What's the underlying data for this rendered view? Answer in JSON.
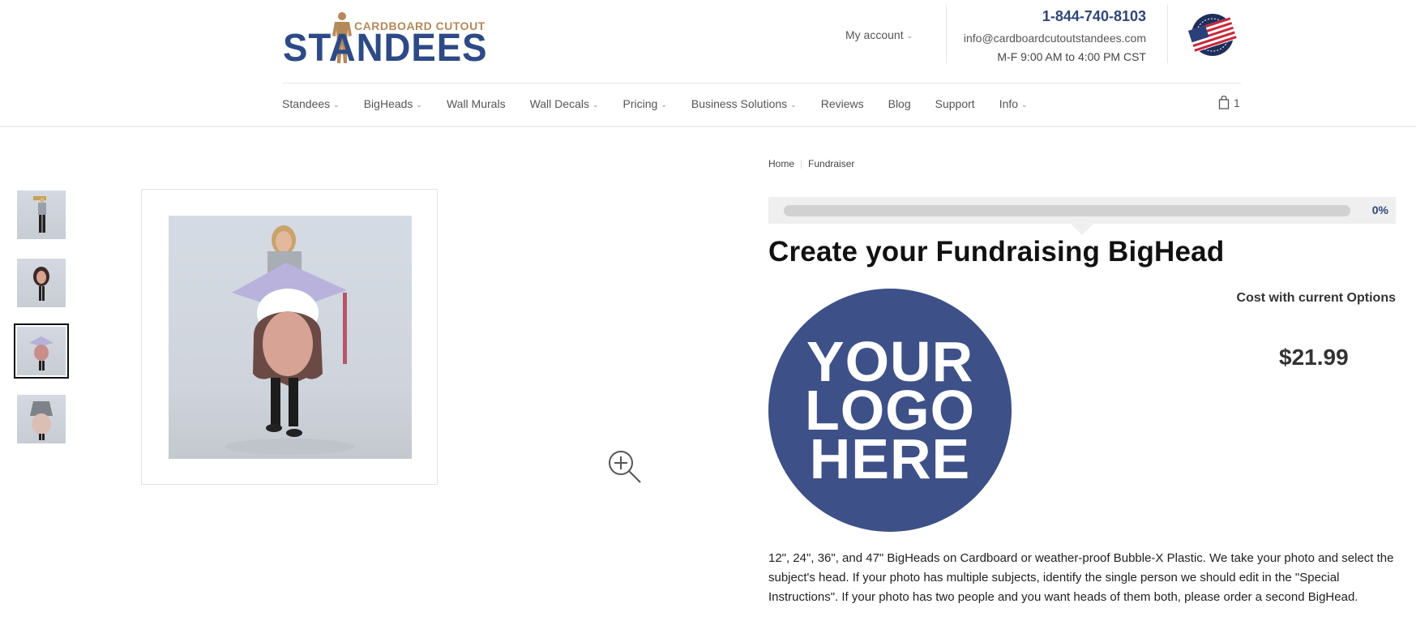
{
  "header": {
    "logo": {
      "tagline": "CARDBOARD CUTOUT",
      "wordmark": "STANDEES",
      "alt": "Cardboard Cutout Standees logo"
    },
    "my_account_label": "My account",
    "contact": {
      "phone": "1-844-740-8103",
      "email": "info@cardboardcutoutstandees.com",
      "hours": "M-F 9:00 AM to 4:00 PM CST"
    },
    "badge": "made-in-usa-flag-badge"
  },
  "nav": {
    "items": [
      {
        "label": "Standees",
        "has_dropdown": true
      },
      {
        "label": "BigHeads",
        "has_dropdown": true
      },
      {
        "label": "Wall Murals",
        "has_dropdown": false
      },
      {
        "label": "Wall Decals",
        "has_dropdown": true
      },
      {
        "label": "Pricing",
        "has_dropdown": true
      },
      {
        "label": "Business Solutions",
        "has_dropdown": true
      },
      {
        "label": "Reviews",
        "has_dropdown": false
      },
      {
        "label": "Blog",
        "has_dropdown": false
      },
      {
        "label": "Support",
        "has_dropdown": false
      },
      {
        "label": "Info",
        "has_dropdown": true
      }
    ],
    "cart_count": "1",
    "dropdown_glyph": "⌄"
  },
  "gallery": {
    "thumbnails": [
      {
        "name": "thumb-person-holding-sign",
        "active": false
      },
      {
        "name": "thumb-bighead-dark-hair",
        "active": false
      },
      {
        "name": "thumb-bighead-graduation",
        "active": true
      },
      {
        "name": "thumb-bighead-military",
        "active": false
      }
    ],
    "main_image": "graduation-bighead-photo"
  },
  "product": {
    "breadcrumb": [
      {
        "label": "Home"
      },
      {
        "label": "Fundraiser"
      }
    ],
    "progress": {
      "percent": 0,
      "label": "0%"
    },
    "title": "Create your Fundraising BigHead",
    "logo_placeholder": {
      "lines": [
        "YOUR",
        "LOGO",
        "HERE"
      ],
      "color": "#3d5087"
    },
    "cost_label": "Cost with current Options",
    "price": "$21.99",
    "description": "12\", 24\", 36\", and 47\" BigHeads on Cardboard or weather-proof Bubble-X Plastic. We take your photo and select the subject's head.  If your photo has multiple subjects, identify the single person we should edit in the \"Special Instructions\".  If your photo has two people and you want heads of them both, please order a second BigHead."
  },
  "colors": {
    "brand_blue": "#2f4778",
    "brand_gold": "#b5895a",
    "logo_circle": "#3d5087"
  }
}
